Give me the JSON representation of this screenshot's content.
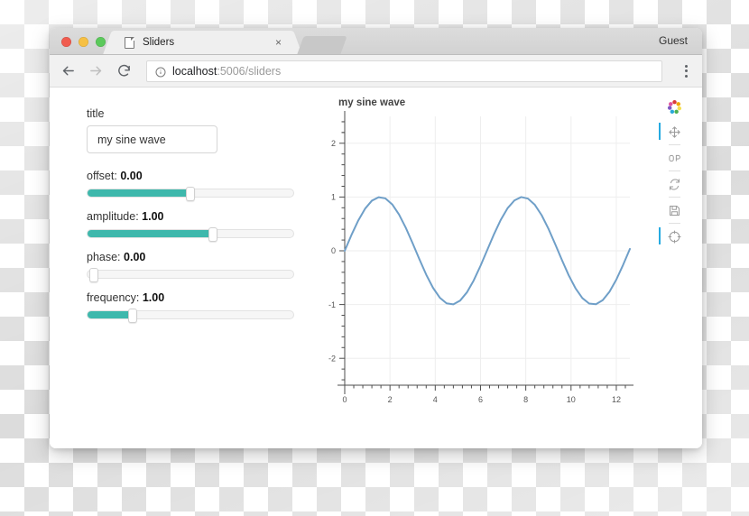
{
  "window": {
    "traffic_lights": [
      "close",
      "minimize",
      "maximize"
    ],
    "guest_label": "Guest"
  },
  "tabs": {
    "active": {
      "title": "Sliders",
      "close_label": "×",
      "favicon": "page-icon"
    }
  },
  "navbar": {
    "back_icon": "back-arrow-icon",
    "forward_icon": "forward-arrow-icon",
    "reload_icon": "reload-icon",
    "security_icon": "info-circle-icon",
    "url_host": "localhost",
    "url_rest": ":5006/sliders",
    "url_full": "localhost:5006/sliders",
    "menu_icon": "three-dot-menu-icon"
  },
  "widgets": {
    "title_field": {
      "label": "title",
      "value": "my sine wave",
      "placeholder": "my sine wave"
    },
    "sliders": [
      {
        "name": "offset",
        "label": "offset:",
        "value": "0.00",
        "percent": 50,
        "accent": "#3eb8ac"
      },
      {
        "name": "amplitude",
        "label": "amplitude:",
        "value": "1.00",
        "percent": 61,
        "accent": "#3eb8ac"
      },
      {
        "name": "phase",
        "label": "phase:",
        "value": "0.00",
        "percent": 0,
        "accent": "#3eb8ac"
      },
      {
        "name": "frequency",
        "label": "frequency:",
        "value": "1.00",
        "percent": 22,
        "accent": "#3eb8ac"
      }
    ]
  },
  "toolbar": {
    "logo_label": "bokeh-logo",
    "tools": [
      {
        "name": "pan-tool",
        "icon": "move-arrows-icon",
        "active": true
      },
      {
        "name": "box-zoom-tool",
        "icon": "box-zoom-icon",
        "active": false
      },
      {
        "name": "reset-tool",
        "icon": "reset-icon",
        "active": false
      },
      {
        "name": "save-tool",
        "icon": "floppy-save-icon",
        "active": false
      },
      {
        "name": "help-tool",
        "icon": "crosshair-help-icon",
        "active": true
      }
    ]
  },
  "chart_data": {
    "type": "line",
    "title": "my sine wave",
    "xlabel": "",
    "ylabel": "",
    "xlim": [
      0,
      12.6
    ],
    "ylim": [
      -2.5,
      2.5
    ],
    "grid": true,
    "legend": "none",
    "line_color": "#6f9fc8",
    "line_width": 2,
    "xticks": [
      0,
      2,
      4,
      6,
      8,
      10,
      12
    ],
    "xtick_labels": [
      "0",
      "2",
      "4",
      "6",
      "8",
      "10",
      "12"
    ],
    "yticks": [
      -2,
      -1,
      0,
      1,
      2
    ],
    "ytick_labels": [
      "-2",
      "-1",
      "0",
      "1",
      "2"
    ],
    "x_minor_per_major": 5,
    "y_minor_per_major": 5,
    "equation": "y = amplitude * sin(frequency * x + phase) + offset",
    "params": {
      "amplitude": 1.0,
      "frequency": 1.0,
      "phase": 0.0,
      "offset": 0.0
    },
    "series": [
      {
        "name": "sine",
        "x": [
          0,
          0.3,
          0.6,
          0.9,
          1.2,
          1.5,
          1.8,
          2.1,
          2.4,
          2.7,
          3.0,
          3.3,
          3.6,
          3.9,
          4.2,
          4.5,
          4.8,
          5.1,
          5.4,
          5.7,
          6.0,
          6.3,
          6.6,
          6.9,
          7.2,
          7.5,
          7.8,
          8.1,
          8.4,
          8.7,
          9.0,
          9.3,
          9.6,
          9.9,
          10.2,
          10.5,
          10.8,
          11.1,
          11.4,
          11.7,
          12.0,
          12.3,
          12.6
        ],
        "y": [
          0.0,
          0.296,
          0.565,
          0.783,
          0.932,
          0.997,
          0.974,
          0.863,
          0.675,
          0.427,
          0.141,
          -0.158,
          -0.443,
          -0.688,
          -0.872,
          -0.978,
          -0.996,
          -0.926,
          -0.773,
          -0.551,
          -0.279,
          0.017,
          0.312,
          0.579,
          0.794,
          0.938,
          0.999,
          0.97,
          0.855,
          0.663,
          0.412,
          0.124,
          -0.174,
          -0.458,
          -0.7,
          -0.88,
          -0.982,
          -0.994,
          -0.919,
          -0.762,
          -0.537,
          -0.263,
          0.034
        ]
      }
    ]
  }
}
